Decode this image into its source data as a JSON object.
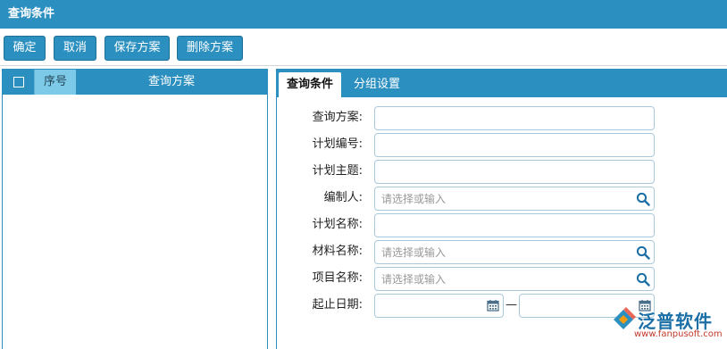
{
  "window": {
    "title": "查询条件"
  },
  "toolbar": {
    "confirm": "确定",
    "cancel": "取消",
    "save_plan": "保存方案",
    "delete_plan": "删除方案"
  },
  "left_panel": {
    "columns": {
      "seq": "序号",
      "plan": "查询方案"
    }
  },
  "tabs": {
    "query_conditions": "查询条件",
    "group_settings": "分组设置"
  },
  "form": {
    "plan_label": "查询方案:",
    "plan_no_label": "计划编号:",
    "plan_subject_label": "计划主题:",
    "preparer_label": "编制人:",
    "preparer_placeholder": "请选择或输入",
    "plan_name_label": "计划名称:",
    "material_name_label": "材料名称:",
    "material_name_placeholder": "请选择或输入",
    "project_name_label": "项目名称:",
    "project_name_placeholder": "请选择或输入",
    "date_range_label": "起止日期:",
    "date_separator": "—"
  },
  "branding": {
    "company": "泛普软件",
    "url": "www.fanpusoft.com"
  },
  "colors": {
    "primary": "#2b8fc0",
    "header_highlight": "#7ccae8",
    "field_border": "#a9c9db"
  }
}
